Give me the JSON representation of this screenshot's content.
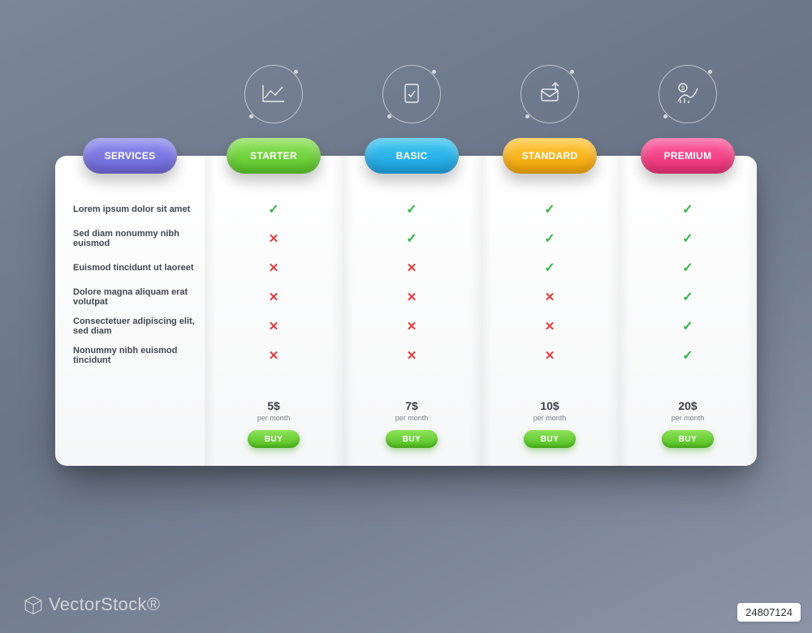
{
  "watermark": "VectorStock®",
  "image_id": "24807124",
  "services_label": "Services",
  "features": [
    "Lorem ipsum dolor sit amet",
    "Sed diam nonummy nibh euismod",
    "Euismod tincidunt ut laoreet",
    "Dolore magna aliquam erat volutpat",
    "Consectetuer adipiscing elit, sed diam",
    "Nonummy nibh euismod tincidunt"
  ],
  "per_label": "per month",
  "buy_label": "Buy",
  "plans": [
    {
      "name": "Starter",
      "price": "5$",
      "color": "c-green",
      "icon": "chart-line-icon",
      "values": [
        true,
        false,
        false,
        false,
        false,
        false
      ]
    },
    {
      "name": "Basic",
      "price": "7$",
      "color": "c-blue",
      "icon": "document-check-icon",
      "values": [
        true,
        true,
        false,
        false,
        false,
        false
      ]
    },
    {
      "name": "Standard",
      "price": "10$",
      "color": "c-orange",
      "icon": "mail-send-icon",
      "values": [
        true,
        true,
        true,
        false,
        false,
        false
      ]
    },
    {
      "name": "Premium",
      "price": "20$",
      "color": "c-pink",
      "icon": "growth-dollar-icon",
      "values": [
        true,
        true,
        true,
        true,
        true,
        true
      ]
    }
  ],
  "colors": {
    "services_tab": "c-purple",
    "check": "#34b54a",
    "cross": "#e23b3b"
  }
}
